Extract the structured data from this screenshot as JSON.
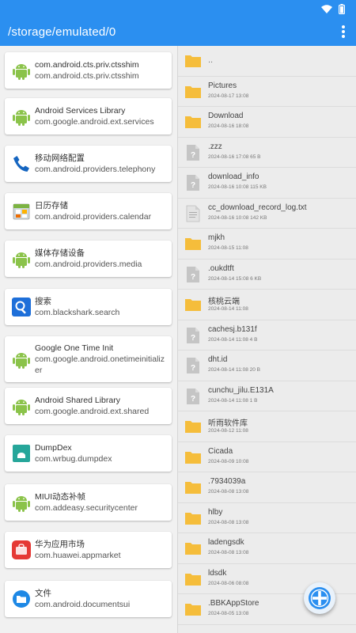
{
  "status_bar": {
    "wifi_icon": "wifi-icon",
    "battery_icon": "battery-icon"
  },
  "app_bar": {
    "title": "/storage/emulated/0",
    "menu_icon": "more-vert-icon"
  },
  "colors": {
    "accent": "#2b8ff0",
    "folder": "#f5bd3b",
    "android_green": "#8bc34a"
  },
  "apps": [
    {
      "label": "com.android.cts.priv.ctsshim",
      "package": "com.android.cts.priv.ctsshim",
      "icon": "android-icon"
    },
    {
      "label": "Android Services Library",
      "package": "com.google.android.ext.services",
      "icon": "android-icon"
    },
    {
      "label": "移动网络配置",
      "package": "com.android.providers.telephony",
      "icon": "phone-icon"
    },
    {
      "label": "日历存储",
      "package": "com.android.providers.calendar",
      "icon": "calendar-icon"
    },
    {
      "label": "媒体存储设备",
      "package": "com.android.providers.media",
      "icon": "android-icon"
    },
    {
      "label": "搜索",
      "package": "com.blackshark.search",
      "icon": "search-icon"
    },
    {
      "label": "Google One Time Init",
      "package": "com.google.android.onetimeinitializer",
      "icon": "android-icon"
    },
    {
      "label": "Android Shared Library",
      "package": "com.google.android.ext.shared",
      "icon": "android-icon"
    },
    {
      "label": "DumpDex",
      "package": "com.wrbug.dumpdex",
      "icon": "dumpdex-icon"
    },
    {
      "label": "MIUI动态补帧",
      "package": "com.addeasy.securitycenter",
      "icon": "android-icon"
    },
    {
      "label": "华为应用市场",
      "package": "com.huawei.appmarket",
      "icon": "huawei-appmarket-icon"
    },
    {
      "label": "文件",
      "package": "com.android.documentsui",
      "icon": "files-icon"
    }
  ],
  "files": [
    {
      "name": "..",
      "meta": "",
      "type": "parent"
    },
    {
      "name": "Pictures",
      "meta": "2024-08-17 13:08",
      "type": "folder"
    },
    {
      "name": "Download",
      "meta": "2024-08-16 18:08",
      "type": "folder"
    },
    {
      "name": ".zzz",
      "meta": "2024-08-16 17:08 65 B",
      "type": "unknown"
    },
    {
      "name": "download_info",
      "meta": "2024-08-16 10:08 115 KB",
      "type": "unknown"
    },
    {
      "name": "cc_download_record_log.txt",
      "meta": "2024-08-16 10:08 142 KB",
      "type": "text"
    },
    {
      "name": "mjkh",
      "meta": "2024-08-15 11:08",
      "type": "folder"
    },
    {
      "name": ".oukdtft",
      "meta": "2024-08-14 15:08 6 KB",
      "type": "unknown"
    },
    {
      "name": "核桃云端",
      "meta": "2024-08-14 11:08",
      "type": "folder"
    },
    {
      "name": "cachesj.b131f",
      "meta": "2024-08-14 11:08 4 B",
      "type": "unknown"
    },
    {
      "name": "dht.id",
      "meta": "2024-08-14 11:08 20 B",
      "type": "unknown"
    },
    {
      "name": "cunchu_jilu.E131A",
      "meta": "2024-08-14 11:08 1 B",
      "type": "unknown"
    },
    {
      "name": "听雨软件库",
      "meta": "2024-08-12 11:08",
      "type": "folder"
    },
    {
      "name": "Cicada",
      "meta": "2024-08-09 10:08",
      "type": "folder"
    },
    {
      "name": ".7934039a",
      "meta": "2024-08-08 13:08",
      "type": "folder"
    },
    {
      "name": "hlby",
      "meta": "2024-08-08 13:08",
      "type": "folder"
    },
    {
      "name": "ladengsdk",
      "meta": "2024-08-08 13:08",
      "type": "folder"
    },
    {
      "name": "ldsdk",
      "meta": "2024-08-06 08:08",
      "type": "folder"
    },
    {
      "name": ".BBKAppStore",
      "meta": "2024-08-05 13:08",
      "type": "folder"
    }
  ],
  "fab": {
    "icon": "add-icon"
  }
}
